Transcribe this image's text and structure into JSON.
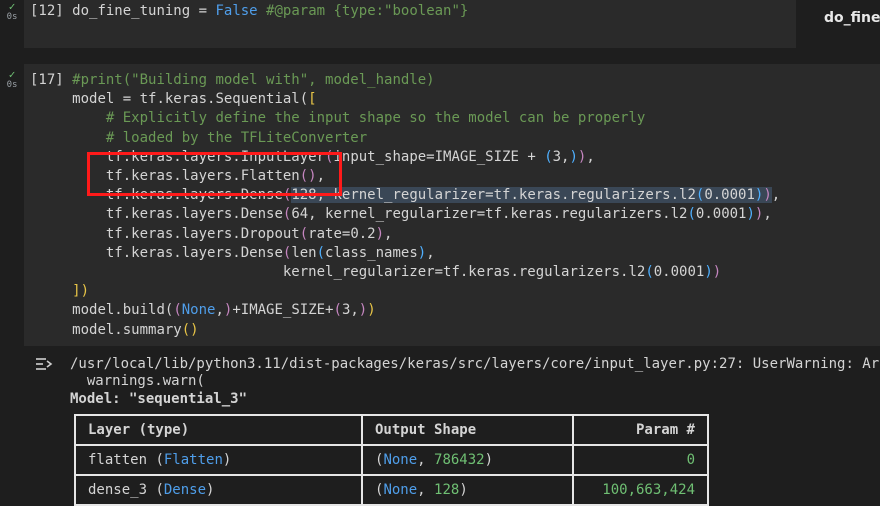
{
  "cell1": {
    "status_time": "0s",
    "prompt": "[12]",
    "var": "do_fine_tuning",
    "eq": " = ",
    "value": "False",
    "comment": " #@param {type:\"boolean\"}"
  },
  "side_form_title": "do_fine_tuning",
  "cell2": {
    "status_time": "0s",
    "prompt": "[17]",
    "l1": "#print(\"Building model with\", model_handle)",
    "l2a": "model = tf.keras.Sequential(",
    "l2b": "[",
    "l3": "    # Explicitly define the input shape so the model can be properly",
    "l4": "    # loaded by the TFLiteConverter",
    "l5a": "    tf.keras.layers.InputLayer",
    "l5b": "(",
    "l5c": "input_shape=IMAGE_SIZE + ",
    "l5d": "(",
    "l5e": "3,",
    "l5f": ")",
    "l5g": ")",
    "l5h": ",",
    "l6a": "    tf.keras.layers.Flatten",
    "l6b": "()",
    "l6c": ",",
    "l7a": "    tf.keras.layers.Dense",
    "l7b": "(",
    "l7c": "128, kernel_regularizer=tf.keras.regularizers.l2",
    "l7d": "(",
    "l7e": "0.0001",
    "l7f": ")",
    "l7g": ")",
    "l7h": ",",
    "l8a": "    tf.keras.layers.Dense",
    "l8b": "(",
    "l8c": "64, kernel_regularizer=tf.keras.regularizers.l2",
    "l8d": "(",
    "l8e": "0.0001",
    "l8f": ")",
    "l8g": ")",
    "l8h": ",",
    "l9a": "    tf.keras.layers.Dropout",
    "l9b": "(",
    "l9c": "rate=0.2",
    "l9d": ")",
    "l9e": ",",
    "l10a": "    tf.keras.layers.Dense",
    "l10b": "(",
    "l10c": "len",
    "l10d": "(",
    "l10e": "class_names",
    "l10f": ")",
    "l10g": ",",
    "l11a": "                         kernel_regularizer=tf.keras.regularizers.l2",
    "l11b": "(",
    "l11c": "0.0001",
    "l11d": ")",
    "l11e": ")",
    "l12": "])",
    "l13a": "model.build(",
    "l13b": "(",
    "l13c": "None",
    "l13d": ",",
    "l13e": ")",
    "l13f": "+IMAGE_SIZE+",
    "l13g": "(",
    "l13h": "3,",
    "l13i": ")",
    "l13j": ")",
    "l14a": "model.summary",
    "l14b": "()"
  },
  "output": {
    "warning_line": "/usr/local/lib/python3.11/dist-packages/keras/src/layers/core/input_layer.py:27: UserWarning: Ar",
    "warn_call": "  warnings.warn(",
    "model_line": "Model: \"sequential_3\"",
    "table": {
      "headers": [
        "Layer (type)",
        "Output Shape",
        "Param #"
      ],
      "rows": [
        {
          "name": "flatten",
          "type": "Flatten",
          "shape_none": "None",
          "shape_val": "786432",
          "params": "0"
        },
        {
          "name": "dense_3",
          "type": "Dense",
          "shape_none": "None",
          "shape_val": "128",
          "params": "100,663,424"
        }
      ]
    }
  },
  "colors": {
    "accent_blue": "#4f9eea",
    "comment_green": "#6a9955",
    "tick_green": "#6fbf73",
    "highlight_red": "#ff1a1a"
  }
}
